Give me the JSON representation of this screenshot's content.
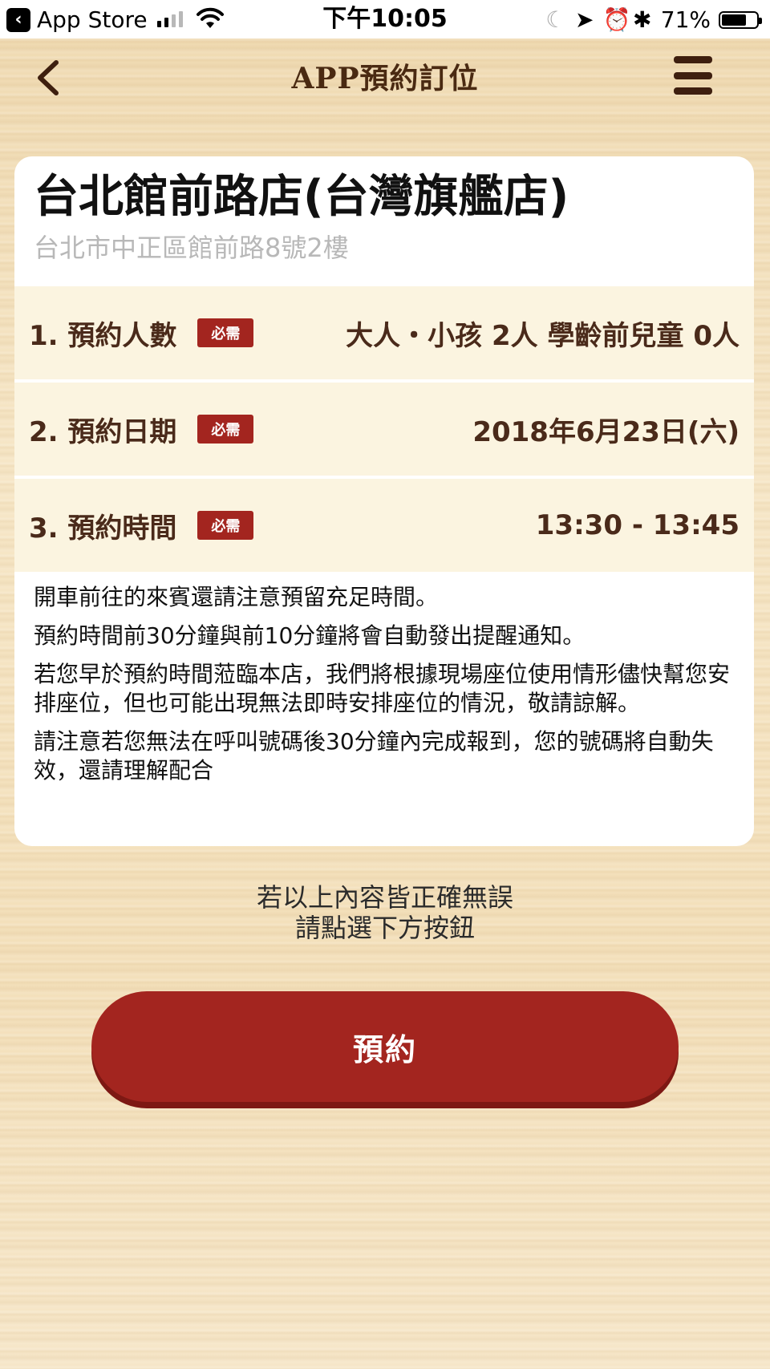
{
  "status_bar": {
    "back_app": "App Store",
    "time": "下午10:05",
    "battery": "71%"
  },
  "nav": {
    "title": "APP預約訂位"
  },
  "store": {
    "name": "台北館前路店(台灣旗艦店)",
    "address": "台北市中正區館前路8號2樓"
  },
  "fields": [
    {
      "label": "1. 預約人數",
      "badge": "必需",
      "value": "大人・小孩 2人 學齡前兒童 0人"
    },
    {
      "label": "2. 預約日期",
      "badge": "必需",
      "value": "2018年6月23日(六)"
    },
    {
      "label": "3. 預約時間",
      "badge": "必需",
      "value": "13:30 - 13:45"
    }
  ],
  "notes": [
    "開車前往的來賓還請注意預留充足時間。",
    "預約時間前30分鐘與前10分鐘將會自動發出提醒通知。",
    "若您早於預約時間蒞臨本店，我們將根據現場座位使用情形儘快幫您安排座位，但也可能出現無法即時安排座位的情況，敬請諒解。",
    "請注意若您無法在呼叫號碼後30分鐘內完成報到，您的號碼將自動失效，還請理解配合"
  ],
  "confirm": {
    "line1": "若以上內容皆正確無誤",
    "line2": "請點選下方按鈕"
  },
  "reserve_button": "預約",
  "colors": {
    "accent_red": "#a3251f",
    "row_bg": "#fbf4e0",
    "text_brown": "#4a2a1a"
  }
}
